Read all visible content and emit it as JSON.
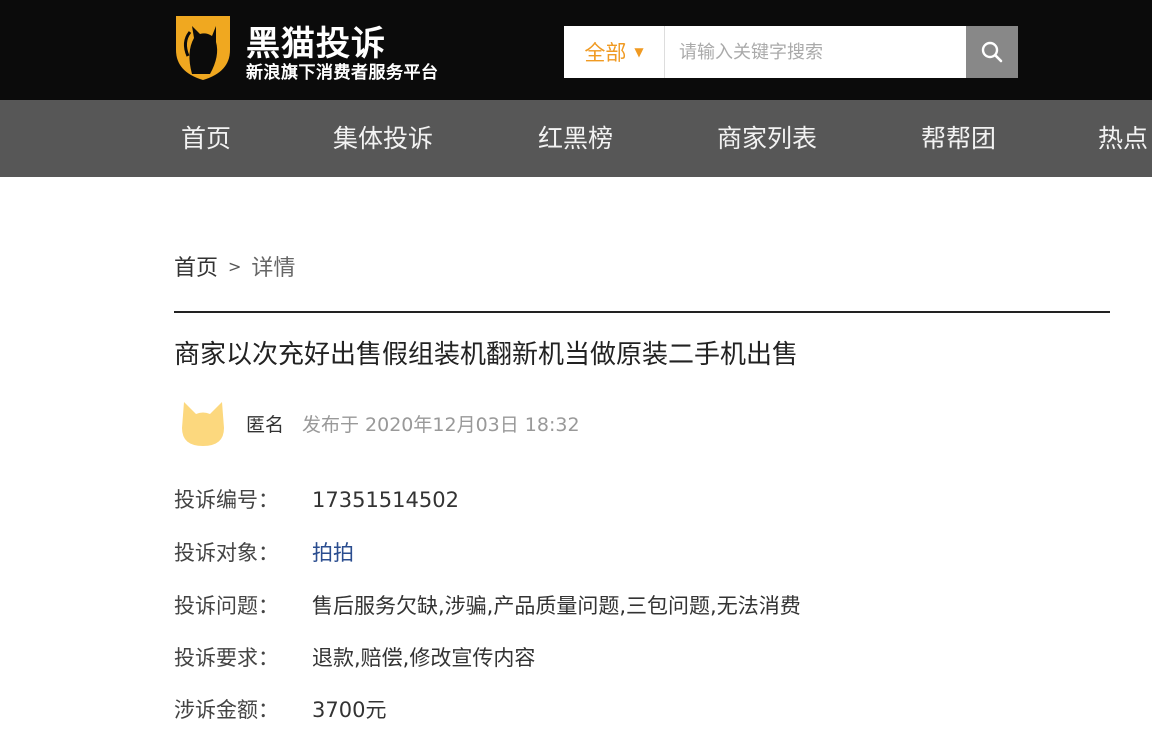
{
  "header": {
    "logo_title": "黑猫投诉",
    "logo_subtitle": "新浪旗下消费者服务平台",
    "search": {
      "scope_label": "全部",
      "placeholder": "请输入关键字搜索"
    }
  },
  "nav": {
    "items": [
      {
        "label": "首页"
      },
      {
        "label": "集体投诉"
      },
      {
        "label": "红黑榜"
      },
      {
        "label": "商家列表"
      },
      {
        "label": "帮帮团"
      },
      {
        "label": "热点"
      }
    ]
  },
  "breadcrumb": {
    "home": "首页",
    "separator": ">",
    "current": "详情"
  },
  "complaint": {
    "title": "商家以次充好出售假组装机翻新机当做原装二手机出售",
    "author": "匿名",
    "published": "发布于 2020年12月03日 18:32",
    "fields": [
      {
        "key": "投诉编号：",
        "value": "17351514502"
      },
      {
        "key": "投诉对象：",
        "value": "拍拍"
      },
      {
        "key": "投诉问题：",
        "value": "售后服务欠缺,涉骗,产品质量问题,三包问题,无法消费"
      },
      {
        "key": "投诉要求：",
        "value": "退款,赔偿,修改宣传内容"
      },
      {
        "key": "涉诉金额：",
        "value": "3700元"
      }
    ]
  },
  "colors": {
    "header_bg": "#0b0b0b",
    "nav_bg": "#575757",
    "accent_orange": "#f09a22",
    "link_blue": "#2a4d8f",
    "search_button": "#888888"
  },
  "icons": [
    "black-cat-shield-logo-icon",
    "caret-down-icon",
    "search-icon",
    "cat-avatar-icon"
  ]
}
